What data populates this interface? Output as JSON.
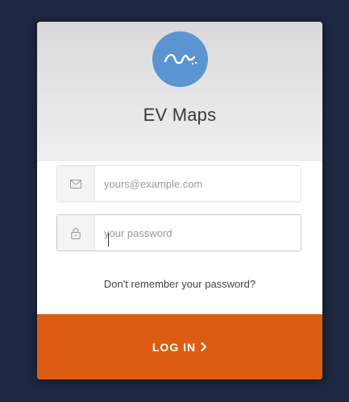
{
  "app": {
    "title": "EV Maps"
  },
  "login_form": {
    "email": {
      "placeholder": "yours@example.com",
      "value": "",
      "icon": "envelope-icon"
    },
    "password": {
      "placeholder": "your password",
      "value": "",
      "icon": "lock-icon"
    },
    "forgot_password_label": "Don't remember your password?",
    "submit_label": "LOG IN",
    "submit_icon": "chevron-right-icon"
  },
  "colors": {
    "background": "#1e2740",
    "logo": "#5b95d1",
    "submit_button": "#dc5d11"
  }
}
